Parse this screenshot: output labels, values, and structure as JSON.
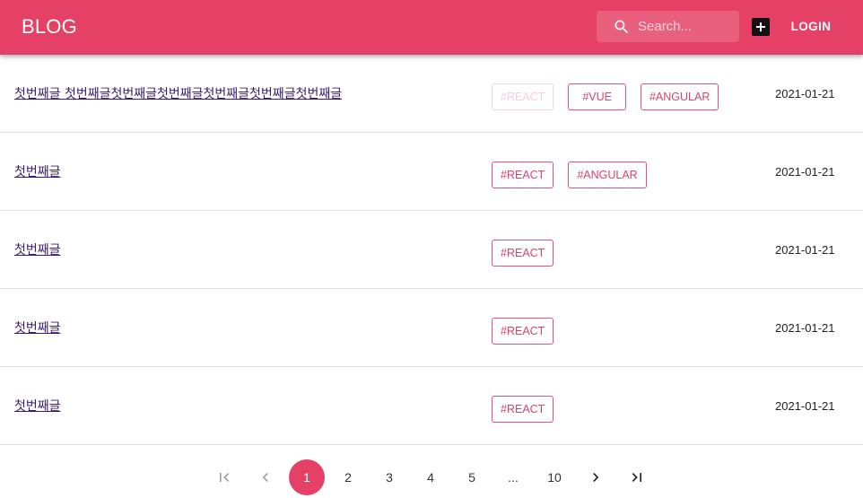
{
  "app": {
    "title": "BLOG"
  },
  "header": {
    "search_placeholder": "Search...",
    "add_icon": "plus-box-icon",
    "login_label": "LOGIN"
  },
  "colors": {
    "primary": "#e54065",
    "tag": "#d9436b",
    "link": "#3b1b6e"
  },
  "posts": [
    {
      "title": "첫번째글 첫번째글첫번째글첫번째글첫번째글첫번째글첫번째글",
      "tags": [
        "#REACT",
        "#VUE",
        "#ANGULAR"
      ],
      "date": "2021-01-21"
    },
    {
      "title": "첫번째글",
      "tags": [
        "#REACT",
        "#ANGULAR"
      ],
      "date": "2021-01-21"
    },
    {
      "title": "첫번째글",
      "tags": [
        "#REACT"
      ],
      "date": "2021-01-21"
    },
    {
      "title": "첫번째글",
      "tags": [
        "#REACT"
      ],
      "date": "2021-01-21"
    },
    {
      "title": "첫번째글",
      "tags": [
        "#REACT"
      ],
      "date": "2021-01-21"
    }
  ],
  "pagination": {
    "first_icon": "first-page-icon",
    "prev_icon": "chevron-left-icon",
    "pages": [
      "1",
      "2",
      "3",
      "4",
      "5",
      "...",
      "10"
    ],
    "current": "1",
    "next_icon": "chevron-right-icon",
    "last_icon": "last-page-icon"
  }
}
